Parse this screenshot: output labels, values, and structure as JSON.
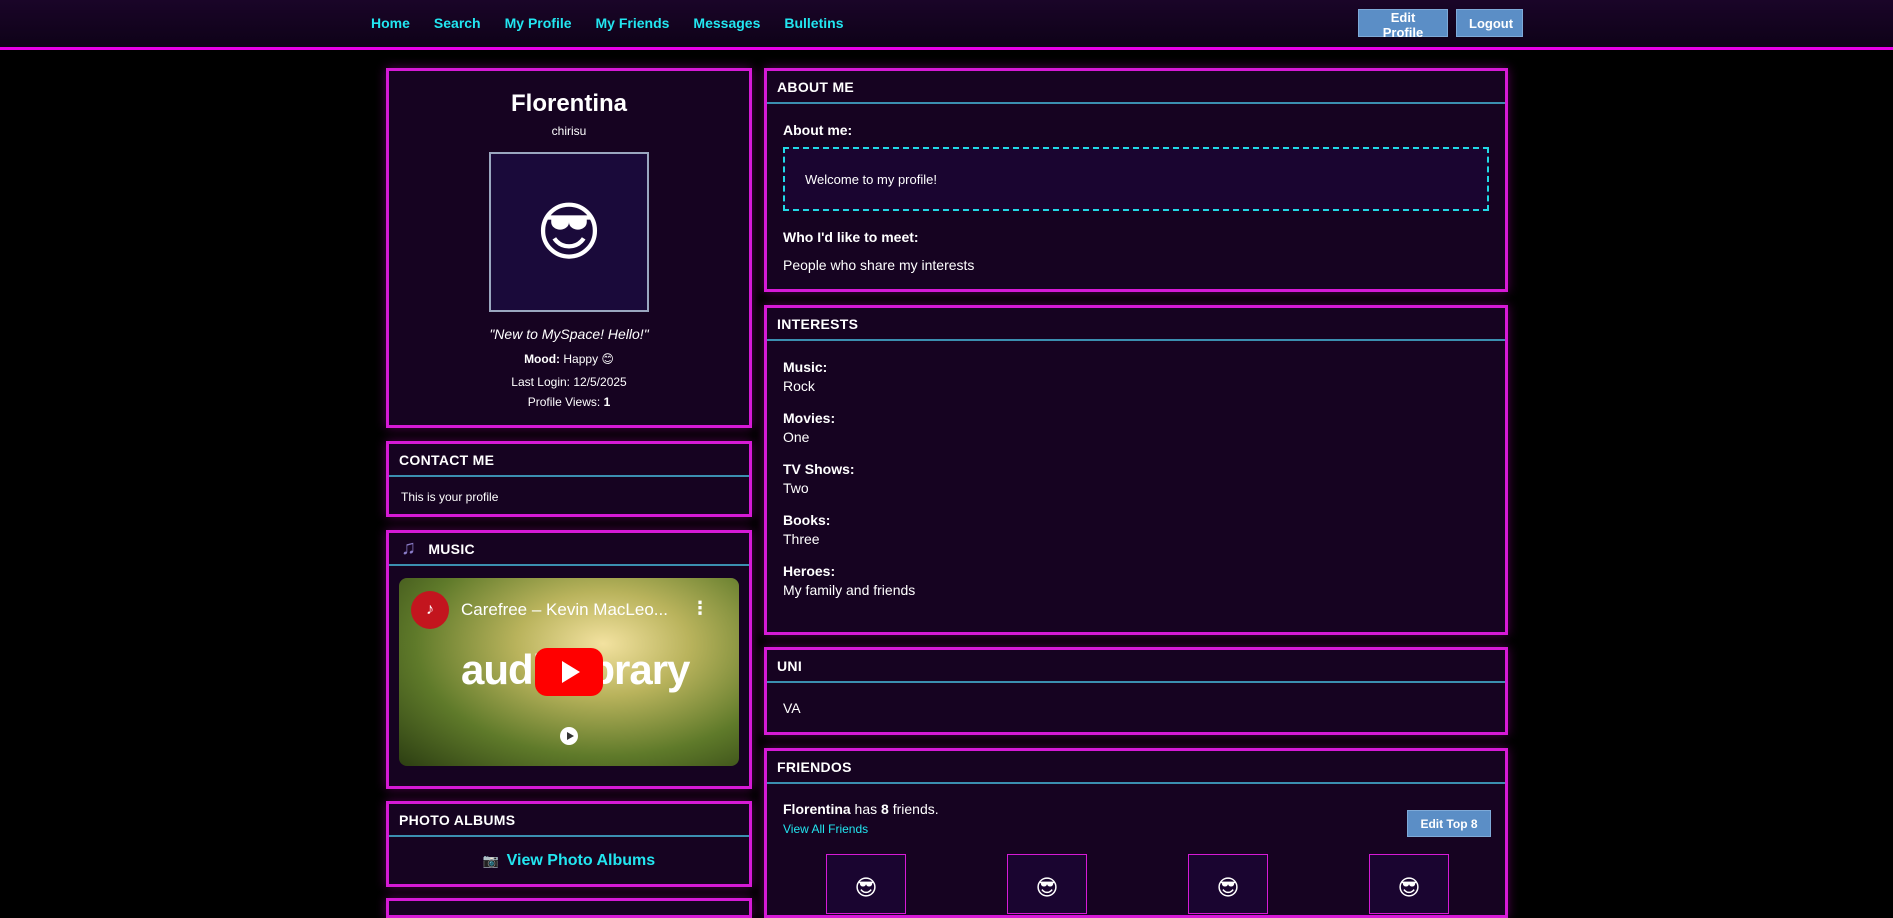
{
  "nav": [
    "Home",
    "Search",
    "My Profile",
    "My Friends",
    "Messages",
    "Bulletins"
  ],
  "top_buttons": {
    "edit_profile": "Edit Profile",
    "logout": "Logout"
  },
  "profile": {
    "name": "Florentina",
    "username": "chirisu",
    "avatar_emoji": "😎",
    "quote": "\"New to MySpace! Hello!\"",
    "mood_label": "Mood:",
    "mood_value": "Happy 😊",
    "last_login": "Last Login: 12/5/2025",
    "views_label": "Profile Views: ",
    "views_count": "1"
  },
  "contact": {
    "title": "CONTACT ME",
    "text": "This is your profile"
  },
  "music": {
    "title": "MUSIC",
    "icon": "music-note-icon",
    "video_title": "Carefree – Kevin MacLeo...",
    "video_overlay": "audiolibrary"
  },
  "photos": {
    "title": "PHOTO ALBUMS",
    "link": "View Photo Albums",
    "icon": "📷"
  },
  "about": {
    "title": "ABOUT ME",
    "about_label": "About me:",
    "about_text": "Welcome to my profile!",
    "meet_label": "Who I'd like to meet:",
    "meet_text": "People who share my interests"
  },
  "interests": {
    "title": "INTERESTS",
    "items": [
      {
        "label": "Music:",
        "value": "Rock"
      },
      {
        "label": "Movies:",
        "value": "One"
      },
      {
        "label": "TV Shows:",
        "value": "Two"
      },
      {
        "label": "Books:",
        "value": "Three"
      },
      {
        "label": "Heroes:",
        "value": "My family and friends"
      }
    ]
  },
  "uni": {
    "title": "UNI",
    "value": "VA"
  },
  "friendos": {
    "title": "FRIENDOS",
    "name": "Florentina",
    "has": " has ",
    "count": "8",
    "suffix": " friends.",
    "view_all": "View All Friends",
    "edit_top8": "Edit Top 8",
    "avatar_emoji": "😎"
  },
  "colors": {
    "accent": "#e600e6",
    "link": "#22e6f0",
    "button": "#5b8ec6",
    "panel_bg": "#160321"
  }
}
